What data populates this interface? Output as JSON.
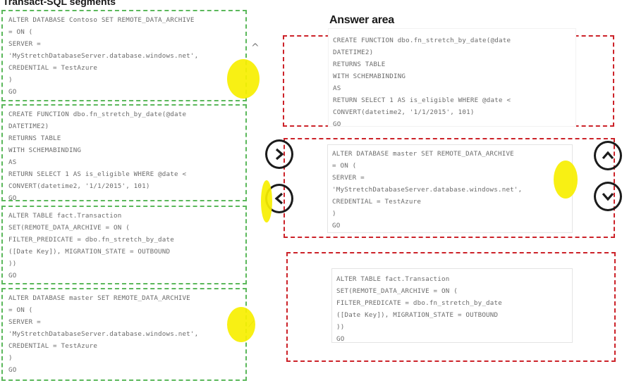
{
  "segments_panel": {
    "title": "Transact-SQL segments",
    "segments": [
      {
        "id": "alter-db-contoso",
        "code": "ALTER DATABASE Contoso SET REMOTE_DATA_ARCHIVE\n= ON (\nSERVER =\n'MyStretchDatabaseServer.database.windows.net',\nCREDENTIAL = TestAzure\n)\nGO"
      },
      {
        "id": "create-function",
        "code": "CREATE FUNCTION dbo.fn_stretch_by_date(@date\nDATETIME2)\nRETURNS TABLE\nWITH SCHEMABINDING\nAS\nRETURN SELECT 1 AS is_eligible WHERE @date <\nCONVERT(datetime2, '1/1/2015', 101)\nGO"
      },
      {
        "id": "alter-table",
        "code": "ALTER TABLE fact.Transaction\nSET(REMOTE_DATA_ARCHIVE = ON (\nFILTER_PREDICATE = dbo.fn_stretch_by_date\n([Date Key]), MIGRATION_STATE = OUTBOUND\n))\nGO"
      },
      {
        "id": "alter-db-master",
        "code": "ALTER DATABASE master SET REMOTE_DATA_ARCHIVE\n= ON (\nSERVER =\n'MyStretchDatabaseServer.database.windows.net',\nCREDENTIAL = TestAzure\n)\nGO"
      }
    ]
  },
  "answer_area": {
    "title": "Answer area",
    "slots": [
      {
        "code": "CREATE FUNCTION dbo.fn_stretch_by_date(@date\nDATETIME2)\nRETURNS TABLE\nWITH SCHEMABINDING\nAS\nRETURN SELECT 1 AS is_eligible WHERE @date <\nCONVERT(datetime2, '1/1/2015', 101)\nGO"
      },
      {
        "code": "ALTER DATABASE master SET REMOTE_DATA_ARCHIVE\n= ON (\nSERVER =\n'MyStretchDatabaseServer.database.windows.net',\nCREDENTIAL = TestAzure\n)\nGO"
      },
      {
        "code": "ALTER TABLE fact.Transaction\nSET(REMOTE_DATA_ARCHIVE = ON (\nFILTER_PREDICATE = dbo.fn_stretch_by_date\n([Date Key]), MIGRATION_STATE = OUTBOUND\n))\nGO"
      }
    ]
  },
  "controls": {
    "move_right_icon": "chevron-right",
    "move_left_icon": "chevron-left",
    "move_up_icon": "chevron-up",
    "move_down_icon": "chevron-down",
    "scroll_up_glyph": "^",
    "scroll_mark_glyph": "|"
  },
  "colors": {
    "source_border": "#5bb85b",
    "target_border": "#cc2229",
    "highlight": "#f7ef00"
  }
}
